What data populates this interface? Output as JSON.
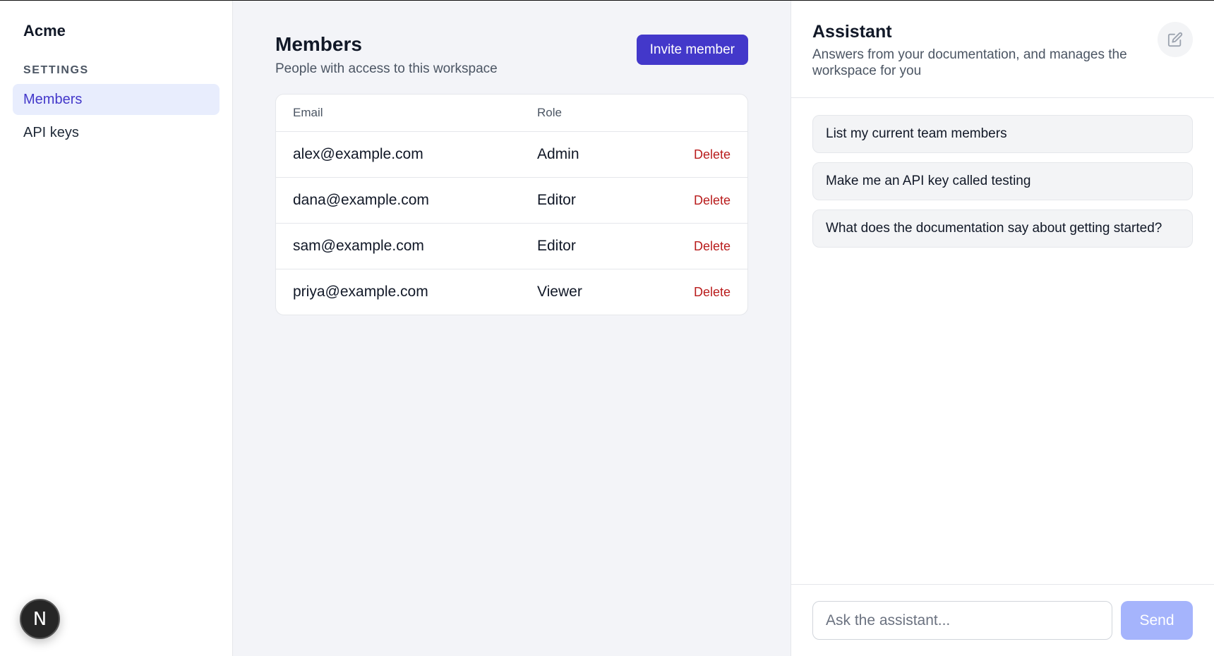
{
  "sidebar": {
    "brand": "Acme",
    "section_label": "SETTINGS",
    "items": [
      {
        "label": "Members",
        "active": true
      },
      {
        "label": "API keys",
        "active": false
      }
    ],
    "fab_label": "N"
  },
  "main": {
    "title": "Members",
    "subtitle": "People with access to this workspace",
    "invite_label": "Invite member",
    "table": {
      "columns": [
        "Email",
        "Role"
      ],
      "rows": [
        {
          "email": "alex@example.com",
          "role": "Admin",
          "action": "Delete"
        },
        {
          "email": "dana@example.com",
          "role": "Editor",
          "action": "Delete"
        },
        {
          "email": "sam@example.com",
          "role": "Editor",
          "action": "Delete"
        },
        {
          "email": "priya@example.com",
          "role": "Viewer",
          "action": "Delete"
        }
      ]
    }
  },
  "assistant": {
    "title": "Assistant",
    "subtitle": "Answers from your documentation, and manages the workspace for you",
    "edit_icon": "edit-icon",
    "suggestions": [
      "List my current team members",
      "Make me an API key called testing",
      "What does the documentation say about getting started?"
    ],
    "input_placeholder": "Ask the assistant...",
    "send_label": "Send"
  },
  "colors": {
    "accent": "#4338ca",
    "danger": "#b91c1c",
    "send_disabled": "#a5b4fc"
  }
}
